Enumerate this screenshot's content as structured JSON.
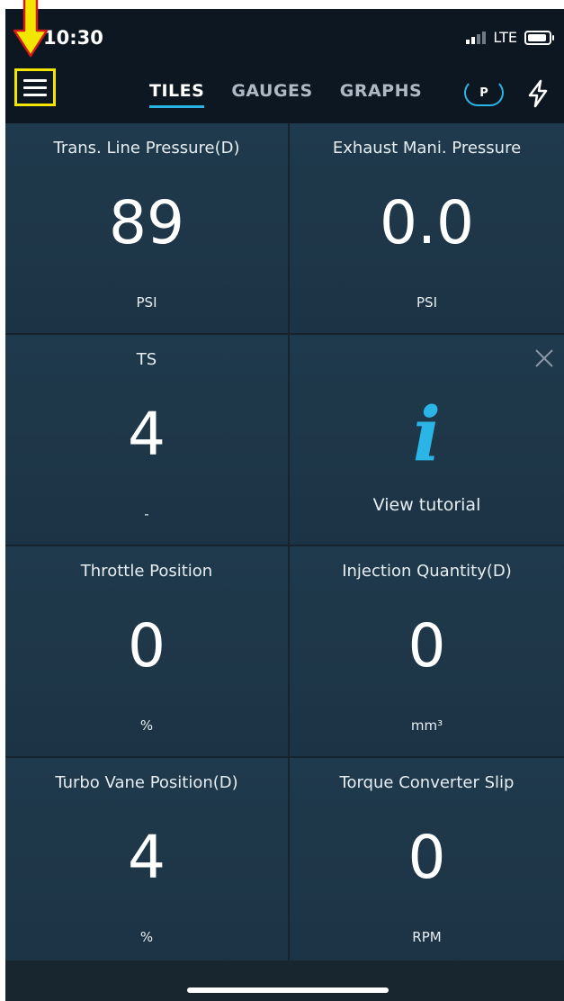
{
  "status": {
    "time": "10:30",
    "network": "LTE"
  },
  "nav": {
    "tabs": [
      {
        "label": "TILES"
      },
      {
        "label": "GAUGES"
      },
      {
        "label": "GRAPHS"
      }
    ],
    "badge": "P"
  },
  "tiles": [
    {
      "title": "Trans. Line Pressure(D)",
      "value": "89",
      "unit": "PSI"
    },
    {
      "title": "Exhaust Mani. Pressure",
      "value": "0.0",
      "unit": "PSI"
    },
    {
      "title": "TS",
      "value": "4",
      "unit": "-"
    },
    {
      "title": "",
      "value": "",
      "unit": ""
    },
    {
      "title": "Throttle Position",
      "value": "0",
      "unit": "%"
    },
    {
      "title": "Injection Quantity(D)",
      "value": "0",
      "unit": "mm³"
    },
    {
      "title": "Turbo Vane Position(D)",
      "value": "4",
      "unit": "%"
    },
    {
      "title": "Torque Converter Slip",
      "value": "0",
      "unit": "RPM"
    }
  ],
  "info_tile": {
    "icon": "info-icon",
    "label": "View tutorial"
  },
  "colors": {
    "accent": "#2ab5e6",
    "highlight": "#f2e600",
    "arrow": "#f2e600"
  }
}
